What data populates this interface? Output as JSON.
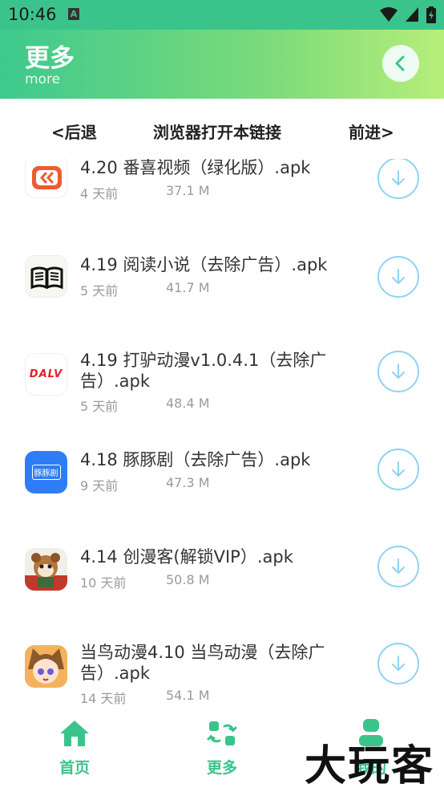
{
  "status_bar": {
    "time": "10:46",
    "notification_icon": "A"
  },
  "header": {
    "title": "更多",
    "subtitle": "more",
    "back_icon": "chevron-left-icon"
  },
  "nav": {
    "back": "<后退",
    "open_in_browser": "浏览器打开本链接",
    "forward": "前进>"
  },
  "items": [
    {
      "title": "4.20 番喜视频（绿化版）.apk",
      "age": "4 天前",
      "size": "37.1 M"
    },
    {
      "title": "4.19 阅读小说（去除广告）.apk",
      "age": "5 天前",
      "size": "41.7 M"
    },
    {
      "title": "4.19 打驴动漫v1.0.4.1（去除广告）.apk",
      "age": "5 天前",
      "size": "48.4 M"
    },
    {
      "title": "4.18 豚豚剧（去除广告）.apk",
      "age": "9 天前",
      "size": "47.3 M"
    },
    {
      "title": "4.14 创漫客(解锁VIP）.apk",
      "age": "10 天前",
      "size": "50.8 M"
    },
    {
      "title": "当鸟动漫4.10 当鸟动漫（去除广告）.apk",
      "age": "14 天前",
      "size": "54.1 M"
    }
  ],
  "app_icon_text": {
    "dalv": "DALV",
    "tuntun": "豚豚剧"
  },
  "tabs": {
    "home": "首页",
    "more": "更多",
    "mine": "我的"
  },
  "watermark": "大玩客",
  "colors": {
    "accent": "#3ac48c",
    "download_ring": "#8fd3f0"
  }
}
